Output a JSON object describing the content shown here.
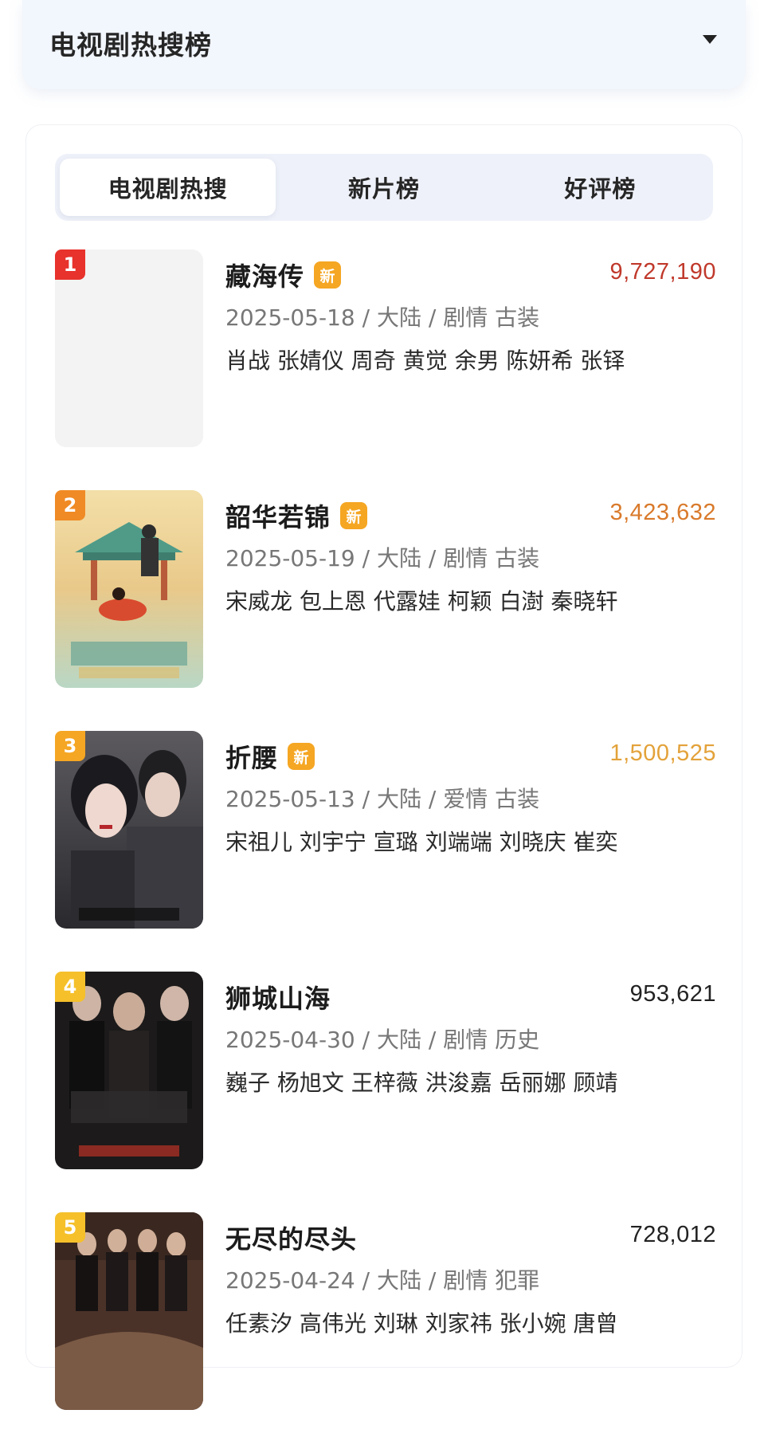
{
  "header": {
    "title": "电视剧热搜榜"
  },
  "tabs": [
    {
      "label": "电视剧热搜",
      "active": true
    },
    {
      "label": "新片榜",
      "active": false
    },
    {
      "label": "好评榜",
      "active": false
    }
  ],
  "items": [
    {
      "rank": "1",
      "rank_color": "#e8322c",
      "title": "藏海传",
      "new_label": "新",
      "has_new": true,
      "hot": "9,727,190",
      "hot_color": "#c0392b",
      "meta": "2025-05-18 / 大陆 / 剧情 古装",
      "cast": "肖战 张婧仪 周奇 黄觉 余男 陈妍希 张铎",
      "poster_theme": "blank"
    },
    {
      "rank": "2",
      "rank_color": "#f08a24",
      "title": "韶华若锦",
      "new_label": "新",
      "has_new": true,
      "hot": "3,423,632",
      "hot_color": "#d97a2b",
      "meta": "2025-05-19 / 大陆 / 剧情 古装",
      "cast": "宋威龙 包上恩 代露娃 柯颖 白澍 秦晓轩",
      "poster_theme": "gold"
    },
    {
      "rank": "3",
      "rank_color": "#f5a623",
      "title": "折腰",
      "new_label": "新",
      "has_new": true,
      "hot": "1,500,525",
      "hot_color": "#e3a23a",
      "meta": "2025-05-13 / 大陆 / 爱情 古装",
      "cast": "宋祖儿 刘宇宁 宣璐 刘端端 刘晓庆 崔奕",
      "poster_theme": "dark"
    },
    {
      "rank": "4",
      "rank_color": "#f5c02a",
      "title": "狮城山海",
      "new_label": "",
      "has_new": false,
      "hot": "953,621",
      "hot_color": "#222222",
      "meta": "2025-04-30 / 大陆 / 剧情 历史",
      "cast": "巍子 杨旭文 王梓薇 洪浚嘉 岳丽娜 顾靖",
      "poster_theme": "noir"
    },
    {
      "rank": "5",
      "rank_color": "#f5c02a",
      "title": "无尽的尽头",
      "new_label": "",
      "has_new": false,
      "hot": "728,012",
      "hot_color": "#222222",
      "meta": "2025-04-24 / 大陆 / 剧情 犯罪",
      "cast": "任素汐 高伟光 刘琳 刘家祎 张小婉 唐曾",
      "poster_theme": "brown"
    }
  ]
}
